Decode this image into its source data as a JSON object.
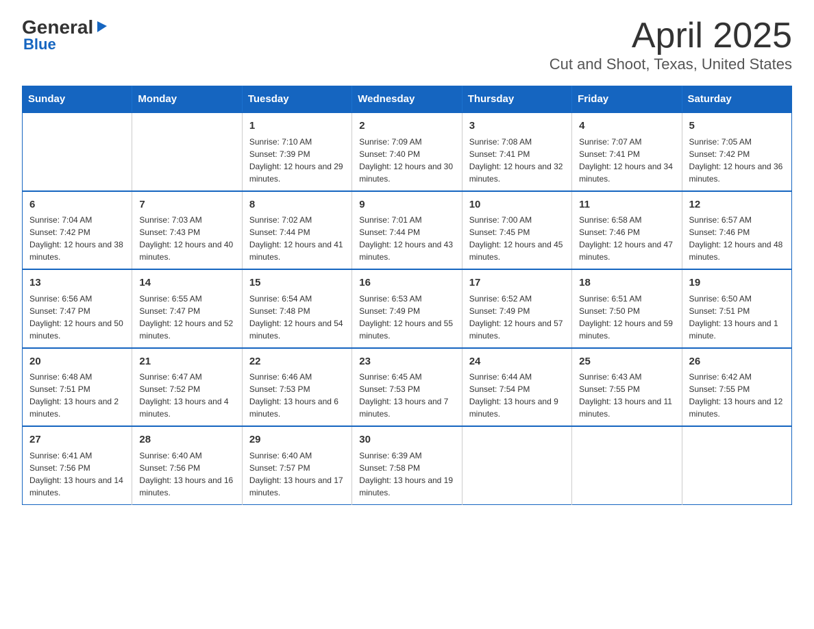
{
  "logo": {
    "general": "General",
    "blue": "Blue",
    "triangle": "▶"
  },
  "title": "April 2025",
  "subtitle": "Cut and Shoot, Texas, United States",
  "days_of_week": [
    "Sunday",
    "Monday",
    "Tuesday",
    "Wednesday",
    "Thursday",
    "Friday",
    "Saturday"
  ],
  "weeks": [
    [
      {
        "day": "",
        "info": ""
      },
      {
        "day": "",
        "info": ""
      },
      {
        "day": "1",
        "info": "Sunrise: 7:10 AM\nSunset: 7:39 PM\nDaylight: 12 hours and 29 minutes."
      },
      {
        "day": "2",
        "info": "Sunrise: 7:09 AM\nSunset: 7:40 PM\nDaylight: 12 hours and 30 minutes."
      },
      {
        "day": "3",
        "info": "Sunrise: 7:08 AM\nSunset: 7:41 PM\nDaylight: 12 hours and 32 minutes."
      },
      {
        "day": "4",
        "info": "Sunrise: 7:07 AM\nSunset: 7:41 PM\nDaylight: 12 hours and 34 minutes."
      },
      {
        "day": "5",
        "info": "Sunrise: 7:05 AM\nSunset: 7:42 PM\nDaylight: 12 hours and 36 minutes."
      }
    ],
    [
      {
        "day": "6",
        "info": "Sunrise: 7:04 AM\nSunset: 7:42 PM\nDaylight: 12 hours and 38 minutes."
      },
      {
        "day": "7",
        "info": "Sunrise: 7:03 AM\nSunset: 7:43 PM\nDaylight: 12 hours and 40 minutes."
      },
      {
        "day": "8",
        "info": "Sunrise: 7:02 AM\nSunset: 7:44 PM\nDaylight: 12 hours and 41 minutes."
      },
      {
        "day": "9",
        "info": "Sunrise: 7:01 AM\nSunset: 7:44 PM\nDaylight: 12 hours and 43 minutes."
      },
      {
        "day": "10",
        "info": "Sunrise: 7:00 AM\nSunset: 7:45 PM\nDaylight: 12 hours and 45 minutes."
      },
      {
        "day": "11",
        "info": "Sunrise: 6:58 AM\nSunset: 7:46 PM\nDaylight: 12 hours and 47 minutes."
      },
      {
        "day": "12",
        "info": "Sunrise: 6:57 AM\nSunset: 7:46 PM\nDaylight: 12 hours and 48 minutes."
      }
    ],
    [
      {
        "day": "13",
        "info": "Sunrise: 6:56 AM\nSunset: 7:47 PM\nDaylight: 12 hours and 50 minutes."
      },
      {
        "day": "14",
        "info": "Sunrise: 6:55 AM\nSunset: 7:47 PM\nDaylight: 12 hours and 52 minutes."
      },
      {
        "day": "15",
        "info": "Sunrise: 6:54 AM\nSunset: 7:48 PM\nDaylight: 12 hours and 54 minutes."
      },
      {
        "day": "16",
        "info": "Sunrise: 6:53 AM\nSunset: 7:49 PM\nDaylight: 12 hours and 55 minutes."
      },
      {
        "day": "17",
        "info": "Sunrise: 6:52 AM\nSunset: 7:49 PM\nDaylight: 12 hours and 57 minutes."
      },
      {
        "day": "18",
        "info": "Sunrise: 6:51 AM\nSunset: 7:50 PM\nDaylight: 12 hours and 59 minutes."
      },
      {
        "day": "19",
        "info": "Sunrise: 6:50 AM\nSunset: 7:51 PM\nDaylight: 13 hours and 1 minute."
      }
    ],
    [
      {
        "day": "20",
        "info": "Sunrise: 6:48 AM\nSunset: 7:51 PM\nDaylight: 13 hours and 2 minutes."
      },
      {
        "day": "21",
        "info": "Sunrise: 6:47 AM\nSunset: 7:52 PM\nDaylight: 13 hours and 4 minutes."
      },
      {
        "day": "22",
        "info": "Sunrise: 6:46 AM\nSunset: 7:53 PM\nDaylight: 13 hours and 6 minutes."
      },
      {
        "day": "23",
        "info": "Sunrise: 6:45 AM\nSunset: 7:53 PM\nDaylight: 13 hours and 7 minutes."
      },
      {
        "day": "24",
        "info": "Sunrise: 6:44 AM\nSunset: 7:54 PM\nDaylight: 13 hours and 9 minutes."
      },
      {
        "day": "25",
        "info": "Sunrise: 6:43 AM\nSunset: 7:55 PM\nDaylight: 13 hours and 11 minutes."
      },
      {
        "day": "26",
        "info": "Sunrise: 6:42 AM\nSunset: 7:55 PM\nDaylight: 13 hours and 12 minutes."
      }
    ],
    [
      {
        "day": "27",
        "info": "Sunrise: 6:41 AM\nSunset: 7:56 PM\nDaylight: 13 hours and 14 minutes."
      },
      {
        "day": "28",
        "info": "Sunrise: 6:40 AM\nSunset: 7:56 PM\nDaylight: 13 hours and 16 minutes."
      },
      {
        "day": "29",
        "info": "Sunrise: 6:40 AM\nSunset: 7:57 PM\nDaylight: 13 hours and 17 minutes."
      },
      {
        "day": "30",
        "info": "Sunrise: 6:39 AM\nSunset: 7:58 PM\nDaylight: 13 hours and 19 minutes."
      },
      {
        "day": "",
        "info": ""
      },
      {
        "day": "",
        "info": ""
      },
      {
        "day": "",
        "info": ""
      }
    ]
  ]
}
